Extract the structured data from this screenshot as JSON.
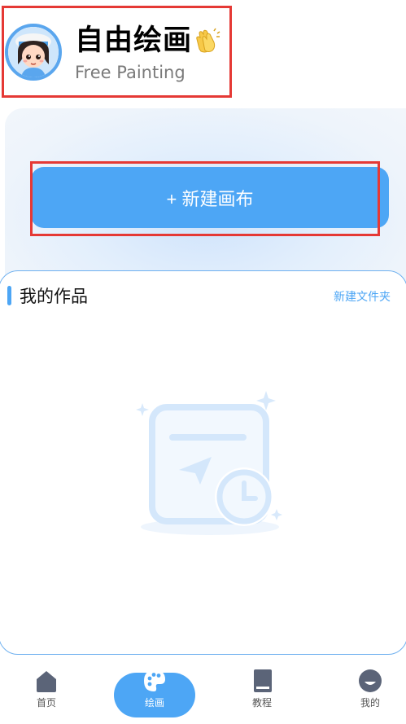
{
  "header": {
    "title": "自由绘画",
    "subtitle": "Free Painting",
    "avatar_icon": "girl-avatar",
    "emoji_icon": "clapping-hands-icon"
  },
  "hero": {
    "new_canvas_label": "+ 新建画布"
  },
  "works": {
    "title": "我的作品",
    "new_folder_label": "新建文件夹",
    "empty_icon": "empty-document-clock-icon"
  },
  "nav": {
    "items": [
      {
        "label": "首页",
        "icon": "home-icon"
      },
      {
        "label": "绘画",
        "icon": "palette-icon",
        "active": true
      },
      {
        "label": "教程",
        "icon": "book-icon"
      },
      {
        "label": "我的",
        "icon": "profile-icon"
      }
    ]
  },
  "colors": {
    "accent": "#4da6f5",
    "highlight_outline": "#e53935",
    "nav_icon": "#5b6478"
  }
}
